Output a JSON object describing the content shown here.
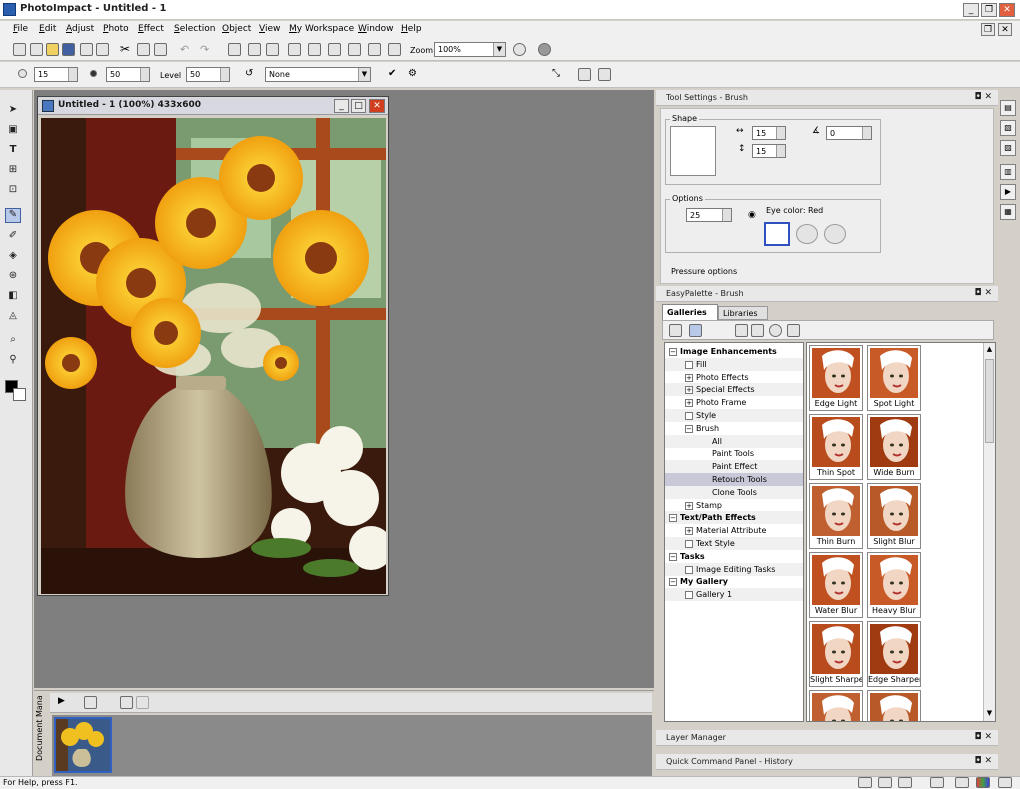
{
  "app": {
    "title": "PhotoImpact - Untitled - 1"
  },
  "menu": [
    "File",
    "Edit",
    "Adjust",
    "Photo",
    "Effect",
    "Selection",
    "Object",
    "View",
    "My Workspace",
    "Window",
    "Help"
  ],
  "toolbar": {
    "zoom_label": "Zoom",
    "zoom_value": "100%"
  },
  "attrbar": {
    "size_value": "15",
    "transparency_value": "50",
    "level_label": "Level",
    "level_value": "50",
    "mode_value": "None"
  },
  "document": {
    "title": "Untitled - 1 (100%) 433x600"
  },
  "docmgr": {
    "label": "Document Mana"
  },
  "tool_settings": {
    "title": "Tool Settings - Brush",
    "shape_label": "Shape",
    "width_value": "15",
    "height_value": "15",
    "angle_value": "0",
    "options_label": "Options",
    "options_value": "25",
    "eye_color_label": "Eye color: Red",
    "pressure_label": "Pressure options"
  },
  "easypalette": {
    "title": "EasyPalette - Brush",
    "tabs": [
      "Galleries",
      "Libraries"
    ],
    "tree": [
      {
        "label": "Image Enhancements",
        "bold": true,
        "level": 0,
        "sign": "−"
      },
      {
        "label": "Fill",
        "level": 1,
        "sign": ""
      },
      {
        "label": "Photo Effects",
        "level": 1,
        "sign": "+"
      },
      {
        "label": "Special Effects",
        "level": 1,
        "sign": "+"
      },
      {
        "label": "Photo Frame",
        "level": 1,
        "sign": "+"
      },
      {
        "label": "Style",
        "level": 1,
        "sign": ""
      },
      {
        "label": "Brush",
        "level": 1,
        "sign": "−"
      },
      {
        "label": "All",
        "level": 2,
        "sign": ""
      },
      {
        "label": "Paint Tools",
        "level": 2,
        "sign": ""
      },
      {
        "label": "Paint Effect",
        "level": 2,
        "sign": ""
      },
      {
        "label": "Retouch Tools",
        "level": 2,
        "sign": "",
        "selected": true
      },
      {
        "label": "Clone Tools",
        "level": 2,
        "sign": ""
      },
      {
        "label": "Stamp",
        "level": 1,
        "sign": "+"
      },
      {
        "label": "Text/Path Effects",
        "bold": true,
        "level": 0,
        "sign": "−"
      },
      {
        "label": "Material Attribute",
        "level": 1,
        "sign": "+"
      },
      {
        "label": "Text Style",
        "level": 1,
        "sign": ""
      },
      {
        "label": "Tasks",
        "bold": true,
        "level": 0,
        "sign": "−"
      },
      {
        "label": "Image Editing Tasks",
        "level": 1,
        "sign": ""
      },
      {
        "label": "My Gallery",
        "bold": true,
        "level": 0,
        "sign": "−"
      },
      {
        "label": "Gallery 1",
        "level": 1,
        "sign": ""
      }
    ],
    "thumbs": [
      "Edge Light",
      "Spot Light",
      "Thin Spot",
      "Wide Burn",
      "Thin Burn",
      "Slight Blur",
      "Water Blur",
      "Heavy Blur",
      "Slight Sharpen",
      "Edge Sharpen",
      "",
      ""
    ]
  },
  "panels": {
    "layer_manager": "Layer Manager",
    "quick_command": "Quick Command Panel - History"
  },
  "status": {
    "text": "For Help, press F1."
  }
}
